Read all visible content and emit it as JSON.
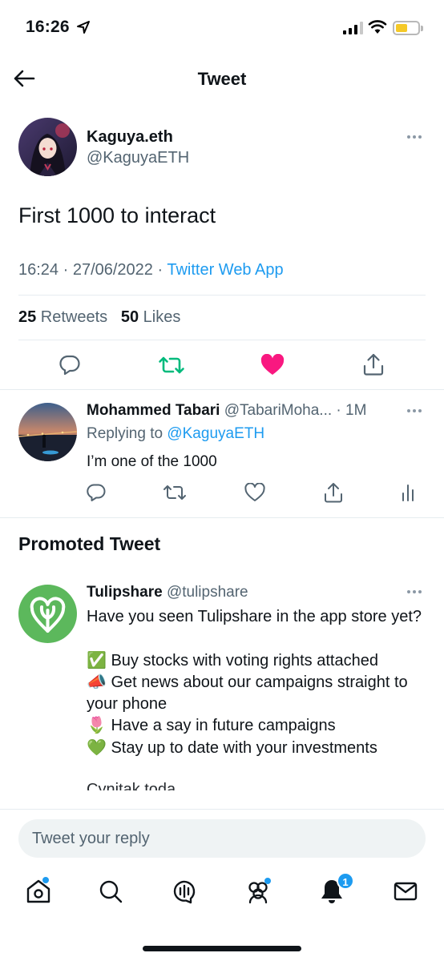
{
  "status_bar": {
    "time": "16:26"
  },
  "header": {
    "title": "Tweet"
  },
  "tweet": {
    "author_name": "Kaguya.eth",
    "author_handle": "@KaguyaETH",
    "text": "First 1000 to interact",
    "timestamp": "16:24 · 27/06/2022 · ",
    "app": "Twitter Web App",
    "retweets_count": "25",
    "retweets_label": " Retweets",
    "likes_count": "50",
    "likes_label": " Likes",
    "liked": true
  },
  "reply": {
    "author_name": "Mohammed Tabari",
    "author_handle": " @TabariMoha... · 1M",
    "replying_prefix": "Replying to ",
    "replying_to": "@KaguyaETH",
    "text": "I’m one of the 1000"
  },
  "promoted": {
    "section_title": "Promoted Tweet",
    "author_name": "Tulipshare",
    "author_handle": " @tulipshare",
    "body": "Have you seen Tulipshare in the app store yet?\n\n✅ Buy stocks with voting rights attached\n📣 Get news about our campaigns straight to your phone\n🌷 Have a say in future campaigns\n💚 Stay up to date with your investments",
    "body_cutoff": "Cynitak toda"
  },
  "composer": {
    "placeholder": "Tweet your reply"
  },
  "bottom_nav": {
    "items": [
      "home-icon",
      "search-icon",
      "spaces-icon",
      "communities-icon",
      "notifications-icon",
      "messages-icon"
    ],
    "notifications_badge": "1"
  },
  "colors": {
    "accent": "#1d9bf0",
    "retweet": "#00ba7c",
    "like": "#f91880",
    "tulipshare_green": "#5cb85c"
  }
}
